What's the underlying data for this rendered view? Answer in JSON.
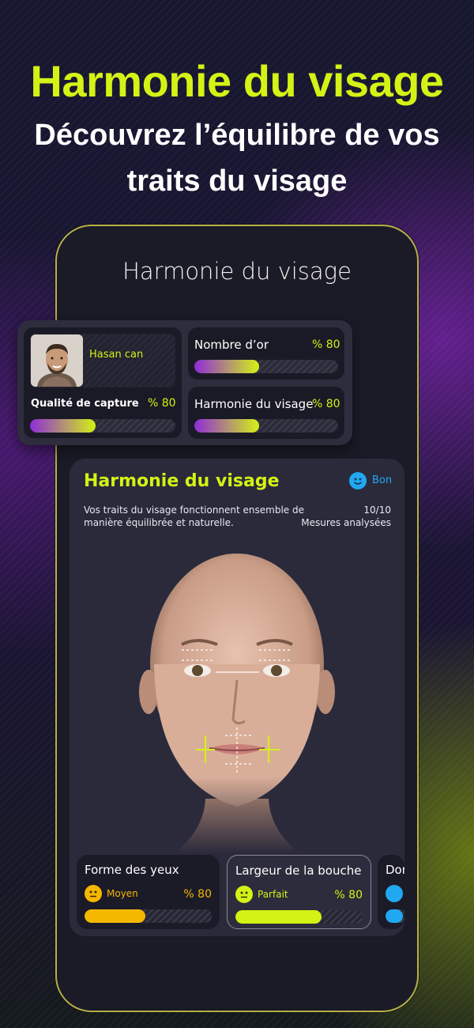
{
  "headline": "Harmonie du visage",
  "subline": "Découvrez l’équilibre de vos traits du visage",
  "phone_title": "Harmonie du visage",
  "profile": {
    "name": "Hasan can",
    "quality_label": "Qualité de capture",
    "quality_pct": "% 80",
    "quality_value": 0.45
  },
  "stats": [
    {
      "label": "Nombre d’or",
      "pct": "% 80",
      "value": 0.45
    },
    {
      "label": "Harmonie du visage",
      "pct": "% 80",
      "value": 0.45
    }
  ],
  "analysis": {
    "title": "Harmonie du visage",
    "badge_label": "Bon",
    "description": "Vos traits du visage fonctionnent ensemble de manière équilibrée et naturelle.",
    "count": "10/10",
    "count_label": "Mesures analysées"
  },
  "metrics": [
    {
      "title": "Forme des yeux",
      "status": "Moyen",
      "pct": "% 80",
      "value": 0.48,
      "color": "#f5b800",
      "icon": "neutral-face-icon"
    },
    {
      "title": "Largeur de la bouche",
      "status": "Parfait",
      "pct": "% 80",
      "value": 0.68,
      "color": "#d4f215",
      "icon": "neutral-face-icon"
    },
    {
      "title": "Dor",
      "status": "",
      "pct": "",
      "value": 0.5,
      "color": "#22a8f0",
      "icon": "smile-face-icon"
    }
  ],
  "colors": {
    "accent": "#d4f215",
    "purple": "#8f2bd9",
    "blue": "#22a8f0",
    "yellow": "#f5b800"
  }
}
